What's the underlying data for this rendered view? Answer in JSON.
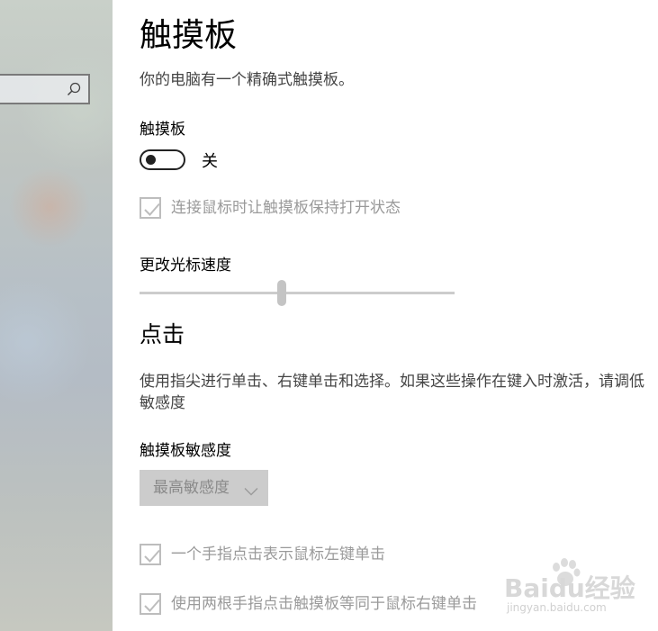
{
  "page": {
    "title": "触摸板",
    "description": "你的电脑有一个精确式触摸板。"
  },
  "touchpad": {
    "label": "触摸板",
    "toggle_state": "关",
    "keep_on_mouse_label": "连接鼠标时让触摸板保持打开状态",
    "keep_on_mouse_checked": true
  },
  "cursor_speed": {
    "label": "更改光标速度",
    "level": 0.45
  },
  "taps": {
    "heading": "点击",
    "description": "使用指尖进行单击、右键单击和选择。如果这些操作在键入时激活，请调低敏感度",
    "sensitivity_label": "触摸板敏感度",
    "sensitivity_value": "最高敏感度",
    "options": [
      {
        "label": "一个手指点击表示鼠标左键单击",
        "checked": true
      },
      {
        "label": "使用两根手指点击触摸板等同于鼠标右键单击",
        "checked": true
      }
    ]
  },
  "sidebar": {
    "search_icon": "search-icon"
  },
  "watermark": {
    "logo": "Baidu经验",
    "url": "jingyan.baidu.com"
  },
  "colors": {
    "disabled_text": "#9a9a9a",
    "slider_track": "#cccccc",
    "dropdown_bg": "#cccccc"
  }
}
